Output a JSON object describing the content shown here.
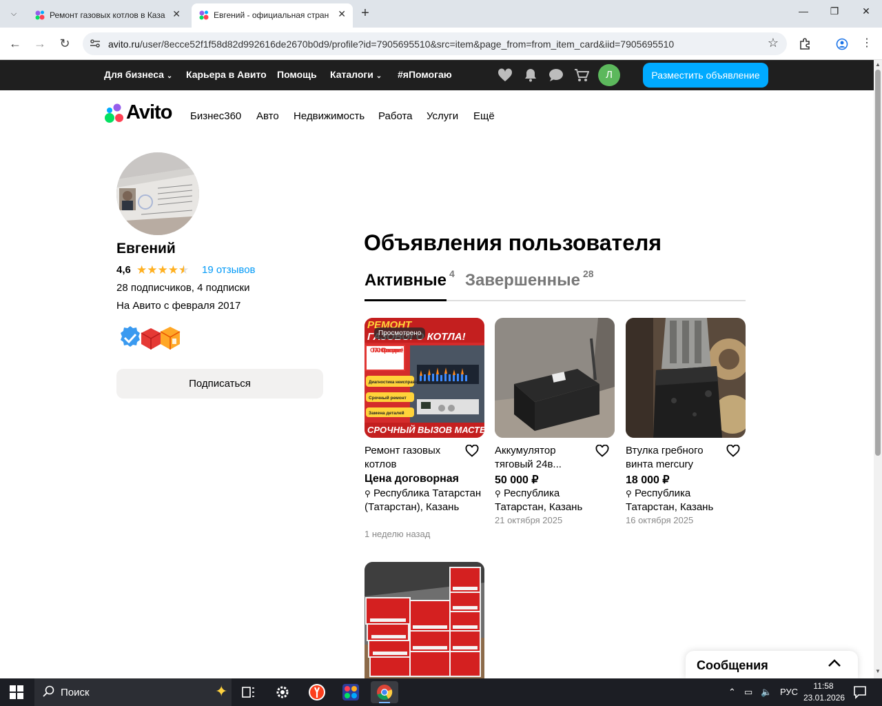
{
  "browser": {
    "tabs": [
      {
        "title": "Ремонт газовых котлов в Каза",
        "active": false
      },
      {
        "title": "Евгений - официальная страни",
        "active": true
      }
    ],
    "address": {
      "domain": "avito.ru",
      "path": "/user/8ecce52f1f58d82d992616de2670b0d9/profile?id=7905695510&src=item&page_from=from_item_card&iid=7905695510"
    }
  },
  "topnav": {
    "items": [
      {
        "label": "Для бизнеса",
        "has_dropdown": true
      },
      {
        "label": "Карьера в Авито",
        "has_dropdown": false
      },
      {
        "label": "Помощь",
        "has_dropdown": false
      },
      {
        "label": "Каталоги",
        "has_dropdown": true
      },
      {
        "label": "#яПомогаю",
        "has_dropdown": false
      }
    ],
    "user_initial": "Л",
    "post_button": "Разместить объявление"
  },
  "logo": {
    "text": "Avito"
  },
  "categories": [
    "Бизнес360",
    "Авто",
    "Недвижимость",
    "Работа",
    "Услуги",
    "Ещё"
  ],
  "profile": {
    "name": "Евгений",
    "rating": "4,6",
    "rating_value": 4.6,
    "reviews": "19 отзывов",
    "subscribers": "28 подписчиков, 4 подписки",
    "since": "На Авито с февраля 2017",
    "subscribe_button": "Подписаться"
  },
  "listings": {
    "title": "Объявления пользователя",
    "tab_active": {
      "label": "Активные",
      "count": "4"
    },
    "tab_done": {
      "label": "Завершенные",
      "count": "28"
    },
    "items": [
      {
        "title": "Ремонт газовых котлов",
        "price": "Цена договорная",
        "location": "Республика Татарстан (Татарстан), Казань",
        "date": "1 неделю назад",
        "badge": "Просмотрено"
      },
      {
        "title": "Аккумулятор тяговый 24в...",
        "price": "50 000 ₽",
        "location": "Республика Татарстан, Казань",
        "date": "21 октября 2025"
      },
      {
        "title": "Втулка гребного винта mercury",
        "price": "18 000 ₽",
        "location": "Республика Татарстан, Казань",
        "date": "16 октября 2025"
      },
      {
        "title": "",
        "price": "",
        "location": "",
        "date": ""
      }
    ],
    "ad_image_text": {
      "line1": "РЕМОНТ",
      "line2": "ГАЗОВОГО КОТЛА!",
      "danger": "ОПАСНО! Срочно подвоните!",
      "check1": "Диагностика неисправностей",
      "check2": "Срочный ремонт",
      "check3": "Замена деталей",
      "bottom": "СРОЧНЫЙ ВЫЗОВ МАСТЕРА!"
    }
  },
  "messages": {
    "label": "Сообщения"
  },
  "taskbar": {
    "search": "Поиск",
    "lang": "РУС",
    "time": "11:58",
    "date": "23.01.2026"
  },
  "colors": {
    "accent": "#00aaff",
    "star": "#ffb021",
    "link": "#0099f7",
    "dark_nav": "#1f1f1f"
  }
}
